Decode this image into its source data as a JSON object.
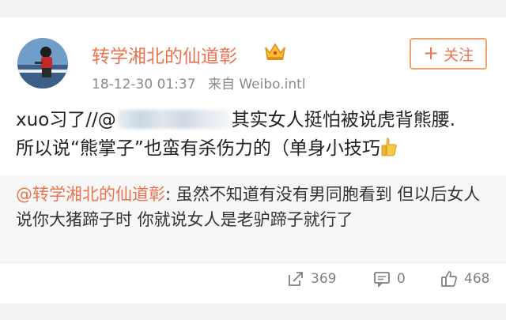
{
  "post": {
    "author": "转学湘北的仙道彰",
    "timestamp": "18-12-30 01:37",
    "source": "来自 Weibo.intl",
    "follow_label": "关注",
    "text_prefix": "xuo习了//@",
    "text_line1_rest": "其实女人挺怕被说虎背熊腰.",
    "text_line2": "所以说“熊掌子”也蛮有杀伤力的（单身小技巧"
  },
  "quoted": {
    "author": "@转学湘北的仙道彰",
    "text": ": 虽然不知道有没有男同胞看到 但以后女人说你大猪蹄子时 你就说女人是老驴蹄子就行了"
  },
  "actions": {
    "reposts": "369",
    "comments": "0",
    "likes": "468"
  },
  "colors": {
    "accent": "#eb7350",
    "meta_gray": "#8a8a8a",
    "quote_bg": "#f7f7f7"
  },
  "icons": {
    "vip": "crown-icon",
    "repost": "repost-icon",
    "comment": "comment-icon",
    "like": "thumbs-up-icon",
    "emoji": "thumbs-up-emoji-icon"
  }
}
